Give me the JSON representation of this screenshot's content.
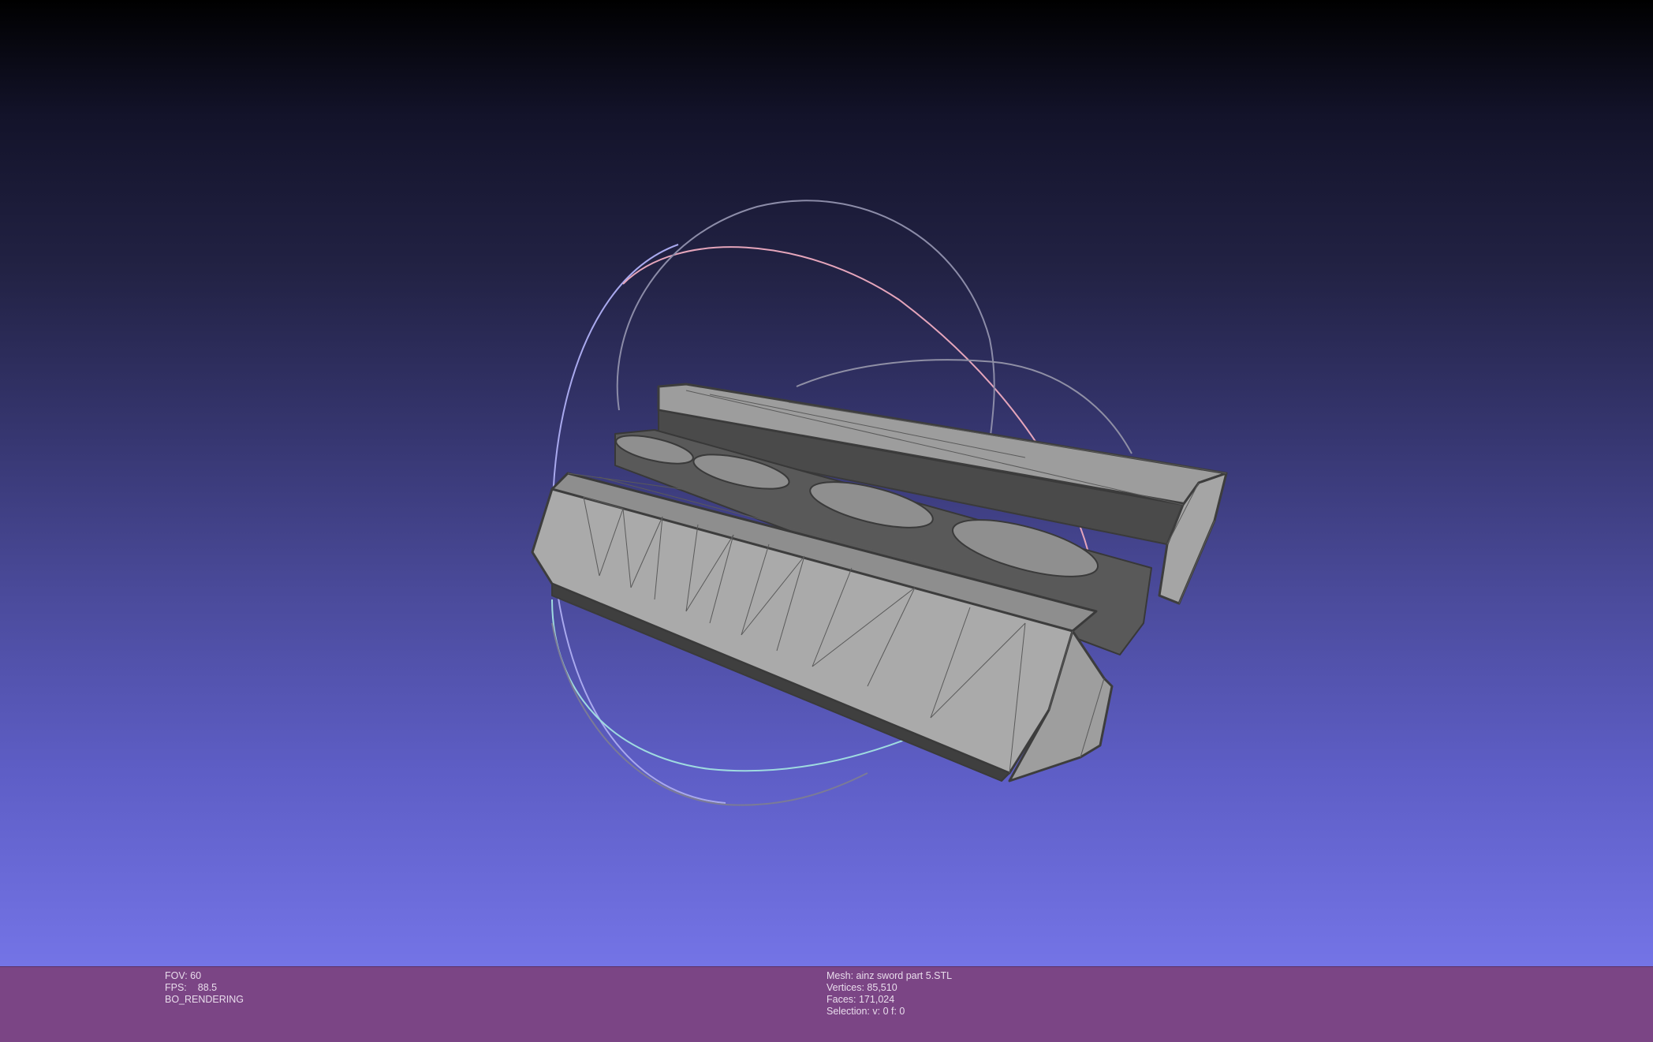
{
  "viewer": {
    "background_top": "#000000",
    "background_bottom": "#7474e6",
    "mesh_color": "#a8a8a8",
    "edge_color": "#404040",
    "trackball_colors": [
      "#8b8bff",
      "#ff9eb0",
      "#a8ffe0",
      "#8a8a9a"
    ]
  },
  "info_left": {
    "fov": "FOV: 60",
    "fps_label": "FPS:",
    "fps_value": "88.5",
    "render_mode": "BO_RENDERING"
  },
  "info_right": {
    "mesh": "Mesh: ainz sword part 5.STL",
    "vertices": "Vertices: 85,510",
    "faces": "Faces: 171,024",
    "selection": "Selection: v: 0 f: 0"
  },
  "status_bar_color": "#7b4585"
}
